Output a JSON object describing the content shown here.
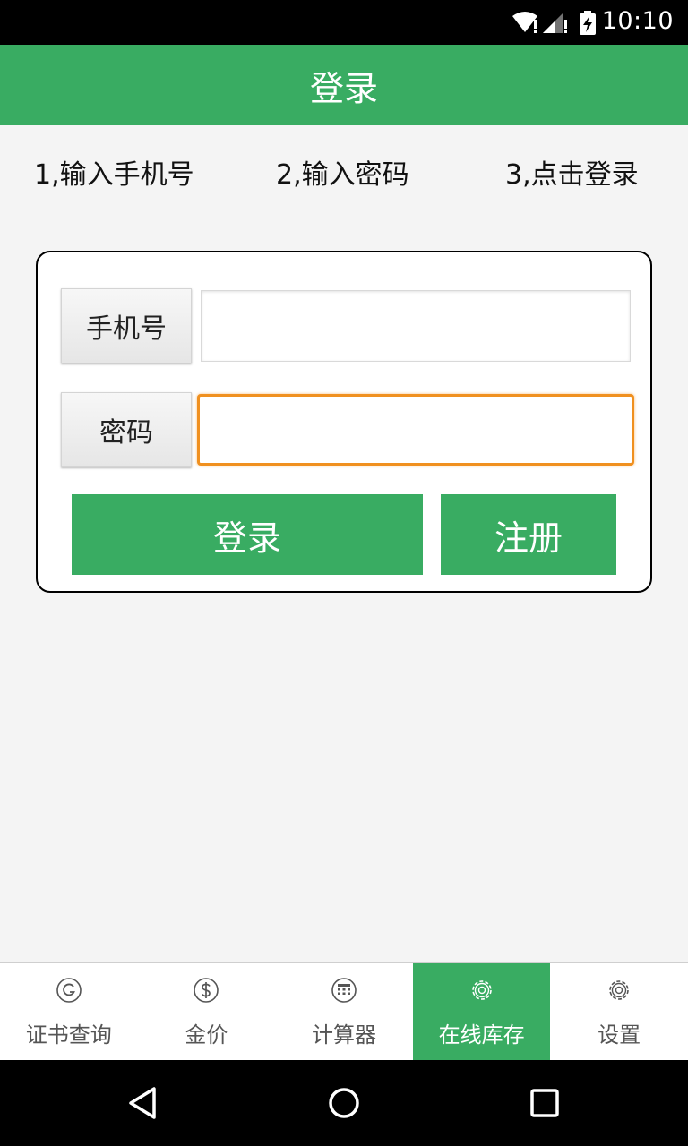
{
  "status_bar": {
    "time": "10:10"
  },
  "app_bar": {
    "title": "登录"
  },
  "steps": [
    "1,输入手机号",
    "2,输入密码",
    "3,点击登录"
  ],
  "form": {
    "phone_label": "手机号",
    "phone_value": "",
    "password_label": "密码",
    "password_value": "",
    "login_label": "登录",
    "register_label": "注册"
  },
  "tabs": [
    {
      "label": "证书查询",
      "icon": "certificate-g-icon",
      "active": false
    },
    {
      "label": "金价",
      "icon": "dollar-icon",
      "active": false
    },
    {
      "label": "计算器",
      "icon": "calculator-icon",
      "active": false
    },
    {
      "label": "在线库存",
      "icon": "gear-icon",
      "active": true
    },
    {
      "label": "设置",
      "icon": "gear-icon",
      "active": false
    }
  ],
  "colors": {
    "primary": "#39ac62",
    "focus": "#f0901f"
  }
}
